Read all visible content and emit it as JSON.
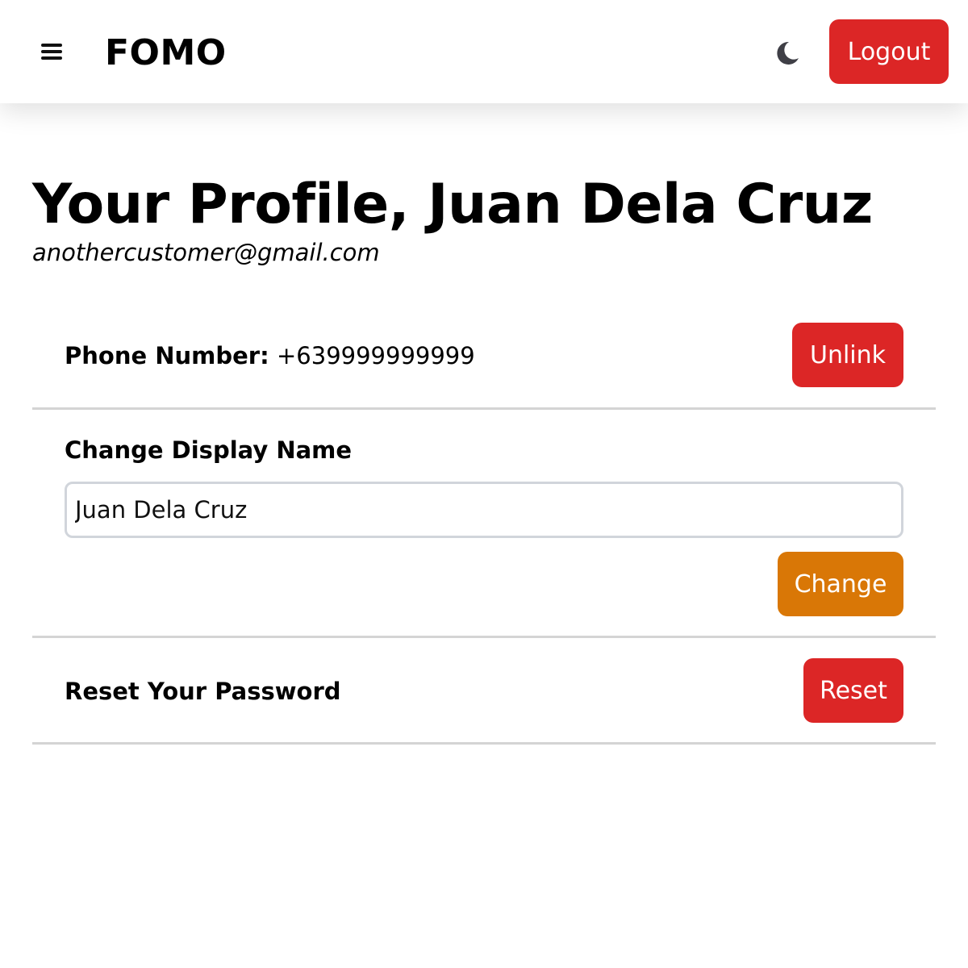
{
  "header": {
    "brand": "FOMO",
    "menu_icon": "hamburger-menu-icon",
    "theme_icon": "moon-icon",
    "logout_label": "Logout"
  },
  "profile": {
    "title": "Your Profile, Juan Dela Cruz",
    "email": "anothercustomer@gmail.com"
  },
  "phone_section": {
    "label": "Phone Number:",
    "value": "+639999999999",
    "button_label": "Unlink"
  },
  "display_name_section": {
    "label": "Change Display Name",
    "input_value": "Juan Dela Cruz",
    "button_label": "Change"
  },
  "password_section": {
    "label": "Reset Your Password",
    "button_label": "Reset"
  },
  "colors": {
    "danger": "#dc2626",
    "warning": "#d97706",
    "divider": "#d4d4d4"
  }
}
